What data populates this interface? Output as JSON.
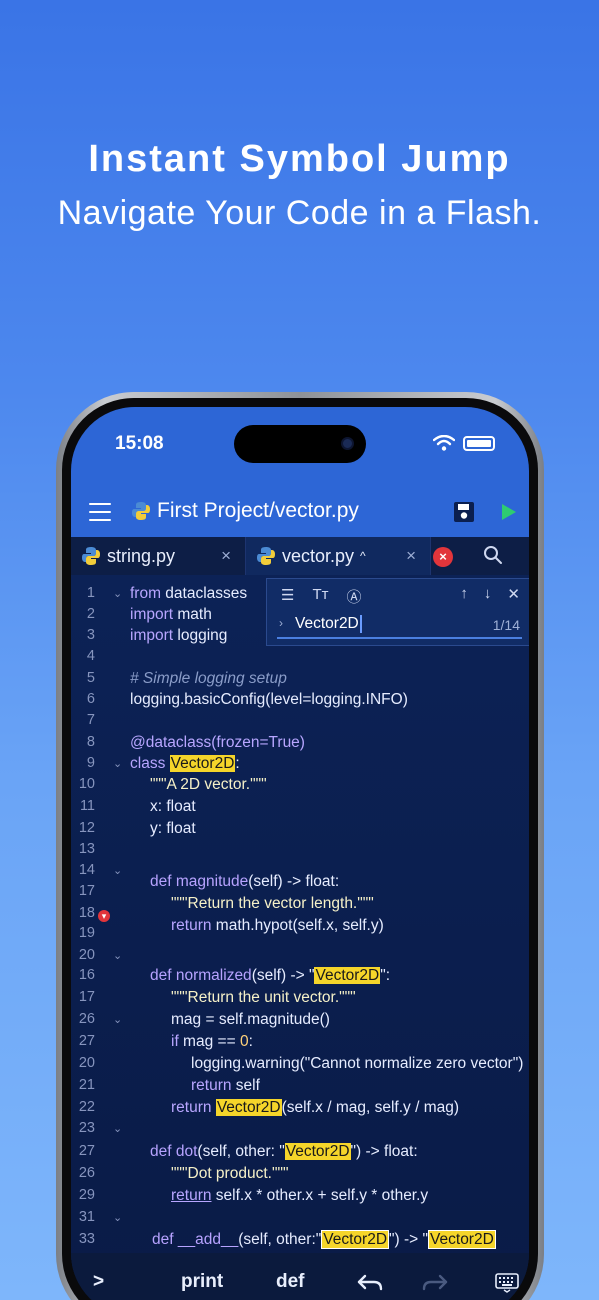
{
  "headline": "Instant Symbol Jump",
  "subline": "Navigate Your Code in a Flash.",
  "status": {
    "time": "15:08"
  },
  "appbar": {
    "title": "First Project/vector.py"
  },
  "tabs": [
    {
      "label": "string.py",
      "close": "×"
    },
    {
      "label": "vector.py",
      "close": "×",
      "chevron": "^"
    }
  ],
  "find": {
    "query": "Vector2D",
    "count": "1/14"
  },
  "editor": {
    "lines": [
      {
        "n": "1",
        "fold": "⌄"
      },
      {
        "n": "2"
      },
      {
        "n": "3"
      },
      {
        "n": "4"
      },
      {
        "n": "5"
      },
      {
        "n": "6"
      },
      {
        "n": "7"
      },
      {
        "n": "8"
      },
      {
        "n": "9",
        "fold": "⌄"
      },
      {
        "n": "10"
      },
      {
        "n": "11"
      },
      {
        "n": "12"
      },
      {
        "n": "13"
      },
      {
        "n": "14",
        "fold": "⌄"
      },
      {
        "n": "17"
      },
      {
        "n": "18",
        "breakpoint": true
      },
      {
        "n": "19"
      },
      {
        "n": "20",
        "fold": "⌄"
      },
      {
        "n": "16"
      },
      {
        "n": "17"
      },
      {
        "n": "26",
        "fold": "⌄"
      },
      {
        "n": "27"
      },
      {
        "n": "20"
      },
      {
        "n": "21"
      },
      {
        "n": "22"
      },
      {
        "n": "23",
        "fold": "⌄"
      },
      {
        "n": "27"
      },
      {
        "n": "26"
      },
      {
        "n": "29"
      },
      {
        "n": "31",
        "fold": "⌄"
      },
      {
        "n": "33"
      }
    ],
    "code": {
      "l1a": "from",
      "l1b": " dataclasses ",
      "l2a": "import",
      "l2b": " math",
      "l3a": "import",
      "l3b": " logging",
      "l5": "# Simple logging setup",
      "l6": "logging.basicConfig(level=logging.INFO)",
      "l8": "@dataclass(frozen=True)",
      "l9a": "class",
      "l10": "\"\"\"A 2D vector.\"\"\"",
      "l11": "x: float",
      "l12": "y: float",
      "l14a": "def",
      "l14b": " magnitude",
      "l14c": "(self) -> float:",
      "l17": "\"\"\"Return the vector length.\"\"\"",
      "l18a": "return",
      "l18b": " math.hypot(self.x, self.y)",
      "l16a": "def",
      "l16b": " normalized",
      "l16c": "(self)  -> \"",
      "l16d": "\":",
      "l17b": "\"\"\"Return the unit vector.\"\"\"",
      "l26": "mag = self.magnitude()",
      "l27a": "if",
      "l27b": " mag == ",
      "l27c": "0",
      "l27d": ":",
      "l20": "logging.warning(\"Cannot normalize zero vector\")",
      "l21a": "return",
      "l21b": " self",
      "l22a": "return",
      "l22c": "(self.x / mag, self.y / mag)",
      "l27e": "def",
      "l27f": " dot",
      "l27g": "(self, other:  \"",
      "l27h": "\") -> float:",
      "l26b": "\"\"\"Dot product.\"\"\"",
      "l29a": "return",
      "l29b": " self.x * other.x + self.y * other.y",
      "l33a": "def",
      "l33b": " __add__",
      "l33c": "(self, other:\"",
      "l33d": "\") -> \"",
      "symbol": "Vector2D"
    }
  },
  "toolbar": {
    "tab_key": ">",
    "print": "print",
    "def": "def"
  },
  "colors": {
    "accent": "#2d66d6",
    "highlight": "#f5d52a",
    "run": "#2ecc71",
    "error": "#e2353b"
  }
}
